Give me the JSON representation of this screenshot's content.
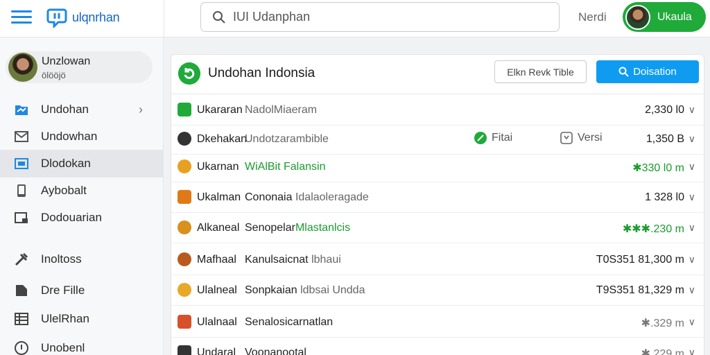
{
  "topbar": {
    "brand": "ulqnrhan",
    "search_placeholder": "IUI Udanphan",
    "nav_text": "Nerdi",
    "user_label": "Ukaula"
  },
  "sidebar": {
    "profile_name": "Unzlowan",
    "profile_sub": "ölööjö",
    "items": [
      {
        "label": "Undohan",
        "icon": "folder-icon"
      },
      {
        "label": "Undowhan",
        "icon": "mail-icon"
      },
      {
        "label": "Dlodokan",
        "icon": "image-icon"
      },
      {
        "label": "Aybobalt",
        "icon": "phone-icon"
      },
      {
        "label": "Dodouarian",
        "icon": "lock-folder-icon"
      },
      {
        "label": "Inoltoss",
        "icon": "tools-icon"
      },
      {
        "label": "Dre Fille",
        "icon": "file-icon"
      },
      {
        "label": "UlelRhan",
        "icon": "table-icon"
      },
      {
        "label": "Unobenl",
        "icon": "info-icon"
      }
    ]
  },
  "main": {
    "title": "Undohan Indonsia",
    "filter_label": "Elkn Revk Tible",
    "primary_label": "Doisation",
    "rows": [
      {
        "name": "Ukararan",
        "desc": "NadolMiaeram",
        "value": "2,330 l0"
      },
      {
        "name": "Dkehakan",
        "desc": "Undotzarambible",
        "tag1": "Fitai",
        "tag2": "Versi",
        "value": "1,350 B"
      },
      {
        "name": "Ukarnan",
        "desc": "WiAlBit Falansin",
        "value": "✱330 l0 m"
      },
      {
        "name": "Ukalman",
        "desc": "Cononaia",
        "desc2": "Idalaoleragade",
        "value": "1 328 l0"
      },
      {
        "name": "Alkaneal",
        "desc": "Senopelar",
        "desc2": "Mlastanlcis",
        "value": "✱✱✱.230 m"
      },
      {
        "name": "Mafhaal",
        "desc": "Kanulsaicnat",
        "desc2": "lbhaui",
        "value": "T0S351 81,300 m"
      },
      {
        "name": "Ulalneal",
        "desc": "Sonpkaian",
        "desc2": "ldbsai Undda",
        "value": "T9S351 81,329 m"
      },
      {
        "name": "Ulalnaal",
        "desc": "Senalosicarnatlan",
        "value": "✱.329 m"
      },
      {
        "name": "Undaral",
        "desc": "Voonanootal",
        "value": "✱.229 m"
      }
    ]
  },
  "colors": {
    "accent_green": "#1faa3a",
    "accent_blue": "#0f9cf0",
    "brand_blue": "#1565c0"
  }
}
